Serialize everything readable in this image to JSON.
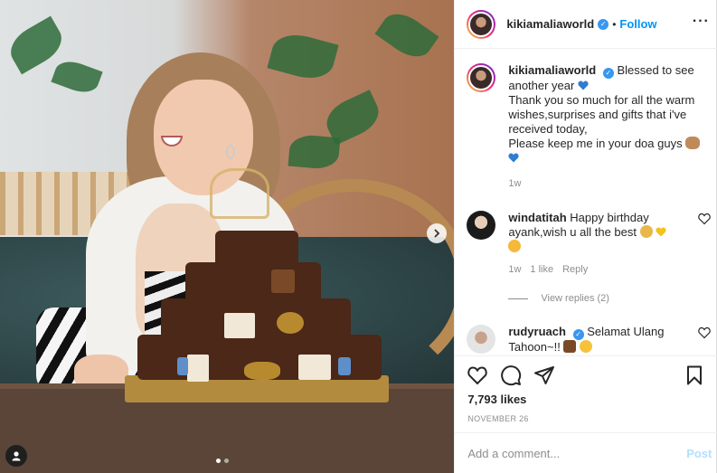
{
  "author": {
    "username": "kikiamaliaworld",
    "verified": true,
    "separator": "•",
    "follow_label": "Follow"
  },
  "header": {
    "more_label": "···"
  },
  "media": {
    "slides": 2,
    "active_slide": 1
  },
  "caption": {
    "username": "kikiamaliaworld",
    "lines": [
      "Blessed to see another year",
      "Thank you so much for all the warm wishes,surprises and gifts that i've received today,",
      "Please keep me in your doa guys"
    ],
    "time": "1w",
    "emojis": [
      "blue-heart",
      "open-hands",
      "blue-heart"
    ]
  },
  "comments": [
    {
      "username": "windatitah",
      "verified": false,
      "text": "Happy birthday ayank,wish u all the best",
      "emojis": [
        "folded-hands",
        "yellow-heart",
        "kiss-face"
      ],
      "time": "1w",
      "likes": "1 like",
      "reply_label": "Reply",
      "view_replies": "View replies (2)"
    },
    {
      "username": "rudyruach",
      "verified": true,
      "text": "Selamat Ulang Tahoon~!!",
      "emojis": [
        "cake",
        "party-face"
      ]
    }
  ],
  "stats": {
    "likes": "7,793 likes",
    "date": "NOVEMBER 26"
  },
  "comment_box": {
    "placeholder": "Add a comment...",
    "post_label": "Post"
  },
  "colors": {
    "link": "#0095f6",
    "verified": "#3897f0",
    "muted": "#8e8e8e",
    "post_disabled": "#b2dffc"
  }
}
